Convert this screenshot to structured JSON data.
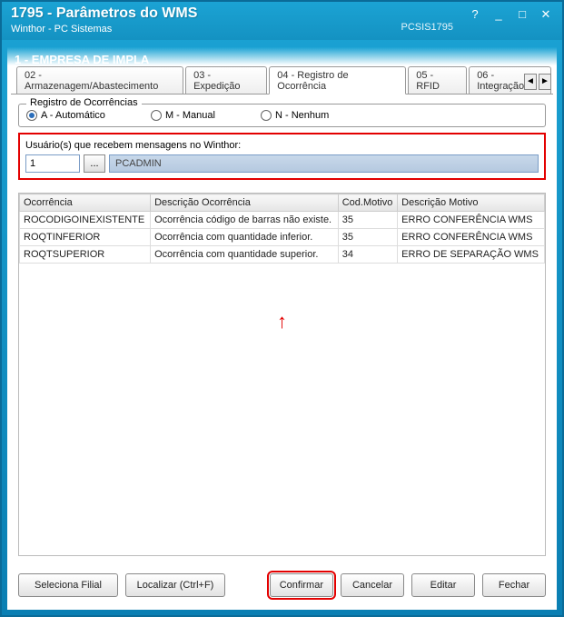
{
  "window": {
    "title": "1795 - Parâmetros do WMS",
    "subtitle": "Winthor - PC Sistemas",
    "code": "PCSIS1795"
  },
  "section": {
    "title": "1 - EMPRESA DE IMPLA"
  },
  "tabs": {
    "items": [
      {
        "label": "02 - Armazenagem/Abastecimento"
      },
      {
        "label": "03 - Expedição"
      },
      {
        "label": "04 - Registro de Ocorrência"
      },
      {
        "label": "05 - RFID"
      },
      {
        "label": "06 - Integração"
      }
    ],
    "active_index": 2
  },
  "registro": {
    "group_label": "Registro de Ocorrências",
    "options": [
      {
        "label": "A - Automático",
        "selected": true
      },
      {
        "label": "M - Manual",
        "selected": false
      },
      {
        "label": "N - Nenhum",
        "selected": false
      }
    ]
  },
  "usuarios": {
    "label": "Usuário(s) que recebem mensagens no Winthor:",
    "code_value": "1",
    "lookup_label": "...",
    "name_value": "PCADMIN"
  },
  "table": {
    "headers": [
      "Ocorrência",
      "Descrição Ocorrência",
      "Cod.Motivo",
      "Descrição Motivo"
    ],
    "rows": [
      [
        "ROCODIGOINEXISTENTE",
        "Ocorrência código de barras não existe.",
        "35",
        "ERRO CONFERÊNCIA WMS"
      ],
      [
        "ROQTINFERIOR",
        "Ocorrência com quantidade inferior.",
        "35",
        "ERRO CONFERÊNCIA WMS"
      ],
      [
        "ROQTSUPERIOR",
        "Ocorrência com quantidade superior.",
        "34",
        "ERRO DE SEPARAÇÃO WMS"
      ]
    ]
  },
  "buttons": {
    "seleciona_filial": "Seleciona Filial",
    "localizar": "Localizar (Ctrl+F)",
    "confirmar": "Confirmar",
    "cancelar": "Cancelar",
    "editar": "Editar",
    "fechar": "Fechar"
  }
}
